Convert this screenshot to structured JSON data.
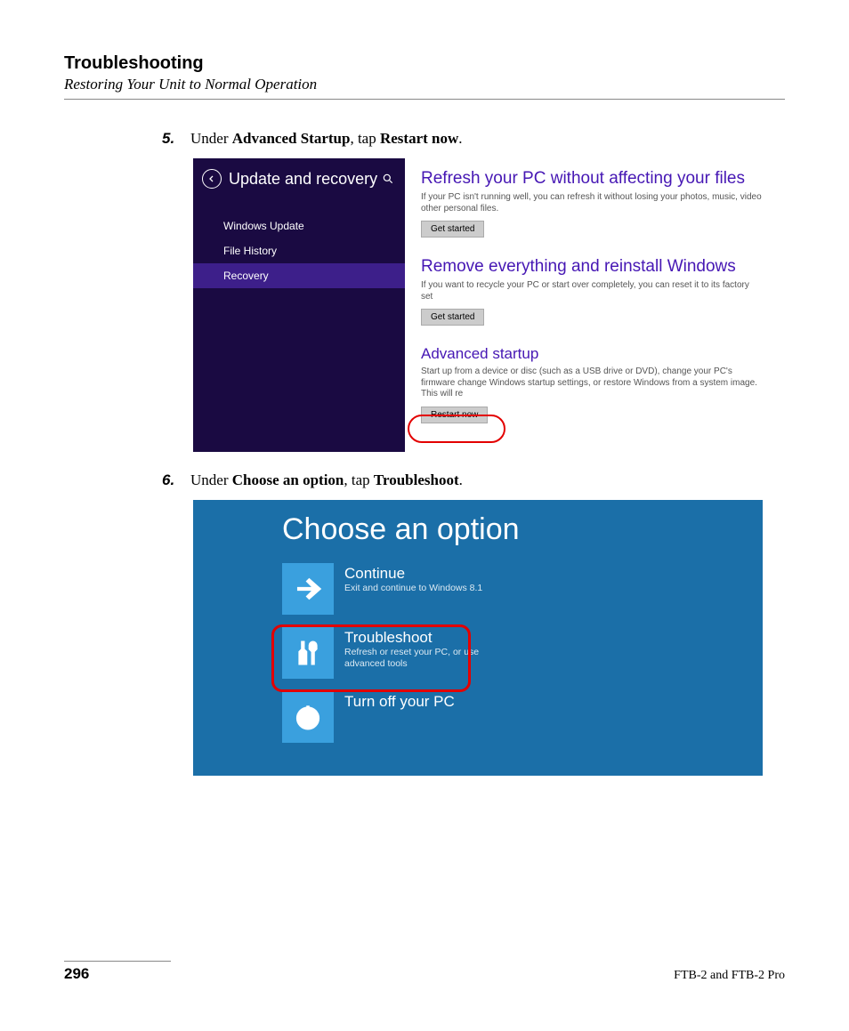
{
  "header": {
    "title": "Troubleshooting",
    "subtitle": "Restoring Your Unit to Normal Operation"
  },
  "steps": {
    "s5": {
      "num": "5.",
      "pre": "Under ",
      "b1": "Advanced Startup",
      "mid": ", tap ",
      "b2": "Restart now",
      "post": "."
    },
    "s6": {
      "num": "6.",
      "pre": "Under ",
      "b1": "Choose an option",
      "mid": ", tap ",
      "b2": "Troubleshoot",
      "post": "."
    }
  },
  "ss1": {
    "title": "Update and recovery",
    "items": [
      "Windows Update",
      "File History",
      "Recovery"
    ],
    "refresh": {
      "h": "Refresh your PC without affecting your files",
      "d": "If your PC isn't running well, you can refresh it without losing your photos, music, video other personal files.",
      "btn": "Get started"
    },
    "remove": {
      "h": "Remove everything and reinstall Windows",
      "d": "If you want to recycle your PC or start over completely, you can reset it to its factory set",
      "btn": "Get started"
    },
    "advanced": {
      "h": "Advanced startup",
      "d": "Start up from a device or disc (such as a USB drive or DVD), change your PC's firmware change Windows startup settings, or restore Windows from a system image. This will re",
      "btn": "Restart now"
    }
  },
  "ss2": {
    "title": "Choose an option",
    "continue": {
      "h": "Continue",
      "d": "Exit and continue to Windows 8.1"
    },
    "troubleshoot": {
      "h": "Troubleshoot",
      "d": "Refresh or reset your PC, or use advanced tools"
    },
    "turnoff": {
      "h": "Turn off your PC",
      "d": ""
    }
  },
  "footer": {
    "page": "296",
    "product": "FTB-2 and FTB-2 Pro"
  }
}
